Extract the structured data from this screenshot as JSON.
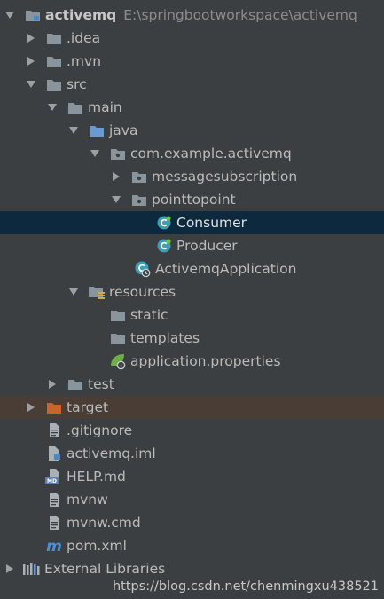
{
  "project": {
    "name": "activemq",
    "path": "E:\\springbootworkspace\\activemq"
  },
  "tree": {
    "idea": ".idea",
    "mvn": ".mvn",
    "src": "src",
    "main": "main",
    "java": "java",
    "package": "com.example.activemq",
    "messagesubscription": "messagesubscription",
    "pointtopoint": "pointtopoint",
    "consumer": "Consumer",
    "producer": "Producer",
    "app": "ActivemqApplication",
    "resources": "resources",
    "static": "static",
    "templates": "templates",
    "app_props": "application.properties",
    "test": "test",
    "target": "target",
    "gitignore": ".gitignore",
    "iml": "activemq.iml",
    "help": "HELP.md",
    "mvnw": "mvnw",
    "mvnw_cmd": "mvnw.cmd",
    "pom": "pom.xml",
    "ext_libs": "External Libraries"
  },
  "watermark": "https://blog.csdn.net/chenmingxu438521",
  "colors": {
    "background": "#3c3f41",
    "selection": "#0d293e",
    "excluded_row": "#4a3d35",
    "folder": "#8a949c",
    "source_folder": "#6b9ad1",
    "excluded_folder": "#c7662c",
    "class_icon": "#3d9eb5"
  }
}
